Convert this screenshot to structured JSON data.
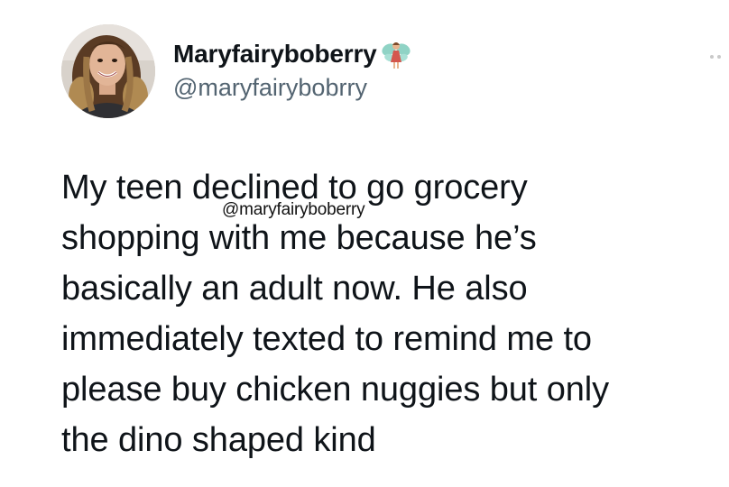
{
  "author": {
    "display_name": "Maryfairyboberry",
    "handle": "@maryfairybobrry",
    "name_emoji": "fairy-emoji"
  },
  "tweet": {
    "text": "My teen declined to go grocery\nshopping with me because he’s\nbasically an adult now. He also\nimmediately texted to remind me to\nplease buy chicken nuggies but only\nthe dino shaped kind"
  },
  "watermark": {
    "text": "@maryfairyboberry"
  },
  "colors": {
    "text": "#0f1419",
    "secondary_text": "#536471",
    "background": "#ffffff"
  }
}
